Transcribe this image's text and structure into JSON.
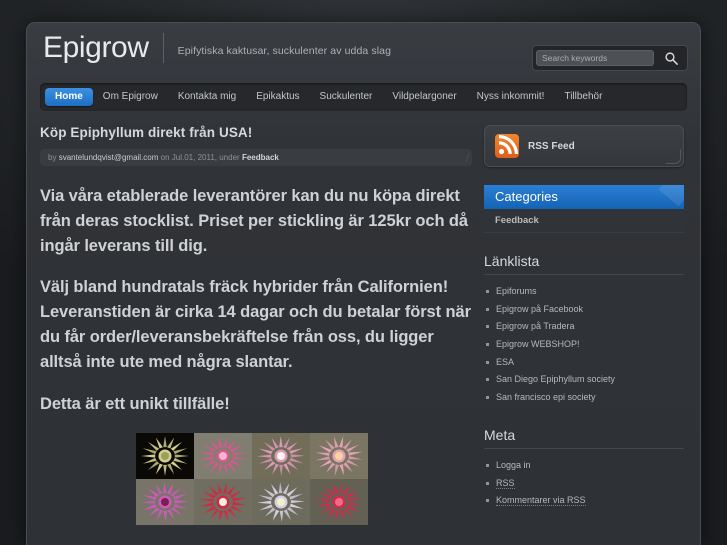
{
  "site": {
    "brand_title": "Epigrow",
    "tagline": "Epifytiska kaktusar, suckulenter av udda slag"
  },
  "search": {
    "placeholder": "Search keywords",
    "value": "",
    "icon": "search-icon"
  },
  "nav": {
    "items": [
      {
        "label": "Home",
        "active": true
      },
      {
        "label": "Om Epigrow",
        "active": false
      },
      {
        "label": "Kontakta mig",
        "active": false
      },
      {
        "label": "Epikaktus",
        "active": false
      },
      {
        "label": "Suckulenter",
        "active": false
      },
      {
        "label": "Vildpelargoner",
        "active": false
      },
      {
        "label": "Nyss inkommit!",
        "active": false
      },
      {
        "label": "Tillbehör",
        "active": false
      }
    ]
  },
  "post": {
    "title": "Köp Epiphyllum direkt från USA!",
    "meta_by": "by",
    "meta_author": "svantelundqvist@gmail.com",
    "meta_on": "on",
    "meta_date": "Jul.01, 2011,",
    "meta_under": "under",
    "meta_category": "Feedback",
    "paragraphs": [
      "Via våra etablerade leverantörer kan du nu köpa direkt från deras stocklist. Priset per stickling är 125kr och då ingår leverans till dig.",
      "Välj bland hundratals fräck hybrider från Californien! Leveranstiden är cirka 14 dagar och du betalar först när du får order/leveransbekräftelse från oss, du ligger alltså inte ute med några slantar.",
      "Detta är ett unikt tillfälle!"
    ]
  },
  "gallery": {
    "name": "epiphyllum-flower-gallery",
    "columns": 4,
    "items": [
      {
        "alt": "Yellow epiphyllum flower on dark background",
        "bg": "#0d0b07",
        "petal": "#e8e49a",
        "center": "#9aa05a"
      },
      {
        "alt": "Deep pink epiphyllum flower",
        "bg": "#8f8d7e",
        "petal": "#e0558f",
        "center": "#f2b5cf"
      },
      {
        "alt": "Pale pink epiphyllum flower on fence",
        "bg": "#7e7a63",
        "petal": "#e79ec2",
        "center": "#fdf4f0"
      },
      {
        "alt": "Salmon pink epiphyllum flower",
        "bg": "#8a8470",
        "petal": "#f0a8bc",
        "center": "#f6d4a0"
      },
      {
        "alt": "Magenta epiphyllum flower",
        "bg": "#868274",
        "petal": "#d957c8",
        "center": "#7a2050"
      },
      {
        "alt": "Red epiphyllum flower",
        "bg": "#7d7b6c",
        "petal": "#e01f3e",
        "center": "#f0f0e0"
      },
      {
        "alt": "White lavender epiphyllum flower",
        "bg": "#7a7866",
        "petal": "#ded9f2",
        "center": "#f3efc8"
      },
      {
        "alt": "Crimson epiphyllum flower",
        "bg": "#6f6d5e",
        "petal": "#e0234f",
        "center": "#ef6b87"
      }
    ]
  },
  "sidebar": {
    "rss": {
      "label": "RSS Feed",
      "icon": "rss-icon"
    },
    "categories": {
      "title": "Categories",
      "items": [
        "Feedback"
      ]
    },
    "linklist": {
      "title": "Länklista",
      "items": [
        "Epiforums",
        "Epigrow på Facebook",
        "Epigrow på Tradera",
        "Epigrow WEBSHOP!",
        "ESA",
        "San Diego Epiphyllum society",
        "San francisco epi society"
      ]
    },
    "meta": {
      "title": "Meta",
      "items": [
        {
          "label": "Logga in",
          "dotted": false
        },
        {
          "label": "RSS",
          "dotted": true
        },
        {
          "label": "Kommentarer via RSS",
          "dotted": true
        }
      ]
    }
  },
  "colors": {
    "accent_blue": "#1c6fc4",
    "rss_orange": "#dd5f1a",
    "page_bg": "#26292c",
    "panel_bg": "#303337",
    "text": "#cfd2d5"
  }
}
